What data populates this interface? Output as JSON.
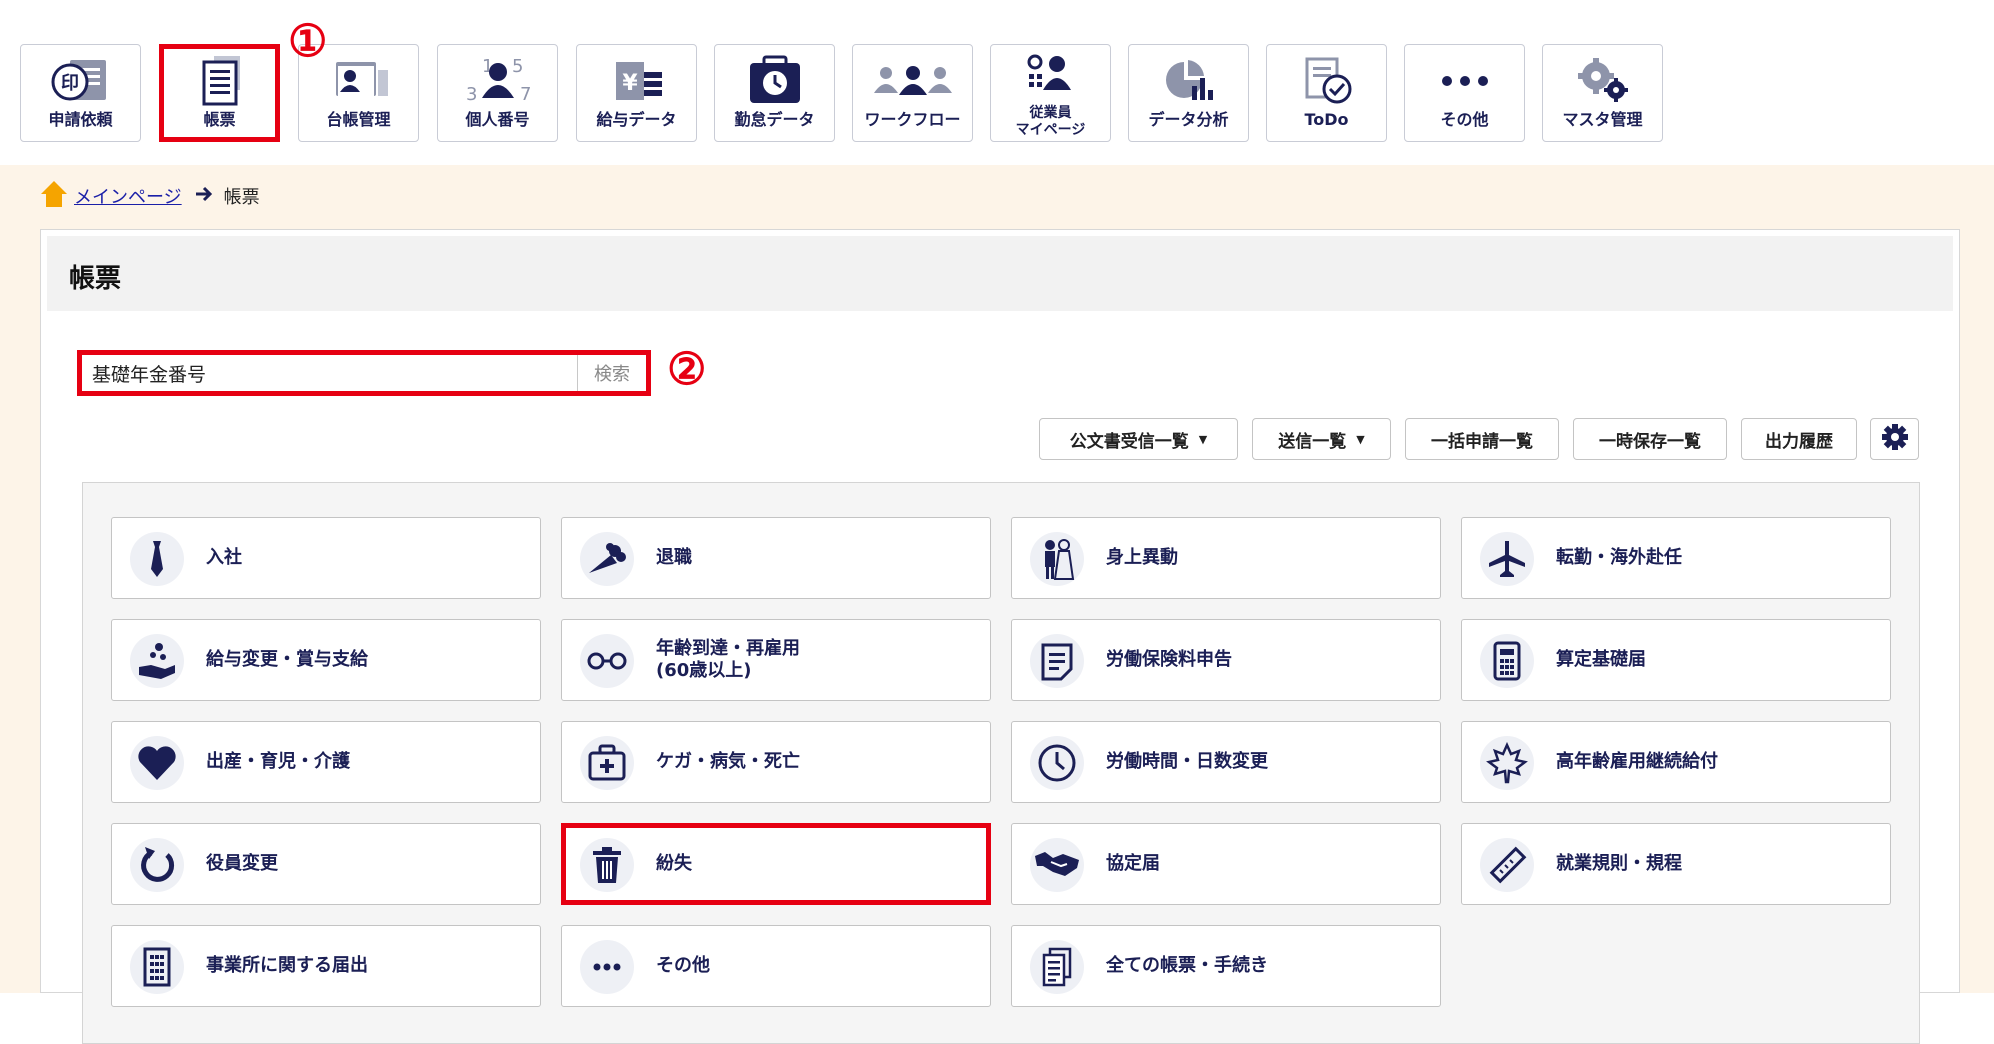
{
  "nav": {
    "items": [
      {
        "label": "申請依頼",
        "icon": "stamp-document-icon"
      },
      {
        "label": "帳票",
        "icon": "document-list-icon"
      },
      {
        "label": "台帳管理",
        "icon": "id-card-icon"
      },
      {
        "label": "個人番号",
        "icon": "person-number-icon"
      },
      {
        "label": "給与データ",
        "icon": "salary-data-icon"
      },
      {
        "label": "勤怠データ",
        "icon": "time-card-icon"
      },
      {
        "label": "ワークフロー",
        "icon": "workflow-people-icon"
      },
      {
        "label": "従業員\nマイページ",
        "icon": "employee-mypage-icon"
      },
      {
        "label": "データ分析",
        "icon": "data-analysis-icon"
      },
      {
        "label": "ToDo",
        "icon": "todo-check-icon"
      },
      {
        "label": "その他",
        "icon": "more-dots-icon"
      },
      {
        "label": "マスタ管理",
        "icon": "gears-icon"
      }
    ],
    "selected_index": 1
  },
  "callouts": {
    "one": "①",
    "two": "②"
  },
  "breadcrumb": {
    "home": "メインページ",
    "current": "帳票"
  },
  "page": {
    "title": "帳票"
  },
  "search": {
    "value": "基礎年金番号",
    "button": "検索"
  },
  "toolbar": {
    "official_received": "公文書受信一覧",
    "sent_list": "送信一覧",
    "bulk_list": "一括申請一覧",
    "temp_saved": "一時保存一覧",
    "output_history": "出力履歴"
  },
  "cards": [
    {
      "label": "入社",
      "icon": "necktie-icon"
    },
    {
      "label": "退職",
      "icon": "bouquet-icon"
    },
    {
      "label": "身上異動",
      "icon": "wedding-couple-icon"
    },
    {
      "label": "転勤・海外赴任",
      "icon": "airplane-icon"
    },
    {
      "label": "給与変更・賞与支給",
      "icon": "coin-hand-icon"
    },
    {
      "label": "年齢到達・再雇用\n(60歳以上)",
      "icon": "glasses-icon"
    },
    {
      "label": "労働保険料申告",
      "icon": "document-icon"
    },
    {
      "label": "算定基礎届",
      "icon": "calculator-icon"
    },
    {
      "label": "出産・育児・介護",
      "icon": "heart-icon"
    },
    {
      "label": "ケガ・病気・死亡",
      "icon": "first-aid-kit-icon"
    },
    {
      "label": "労働時間・日数変更",
      "icon": "clock-icon"
    },
    {
      "label": "高年齢雇用継続給付",
      "icon": "maple-leaf-icon"
    },
    {
      "label": "役員変更",
      "icon": "refresh-icon"
    },
    {
      "label": "紛失",
      "icon": "trash-icon"
    },
    {
      "label": "協定届",
      "icon": "handshake-icon"
    },
    {
      "label": "就業規則・規程",
      "icon": "ruler-icon"
    },
    {
      "label": "事業所に関する届出",
      "icon": "building-icon"
    },
    {
      "label": "その他",
      "icon": "more-dots-icon"
    },
    {
      "label": "全ての帳票・手続き",
      "icon": "documents-stack-icon"
    }
  ],
  "selected_card_index": 13,
  "colors": {
    "accent_red": "#e60012",
    "navy": "#1b1f55",
    "content_bg": "#fdf4e8"
  }
}
